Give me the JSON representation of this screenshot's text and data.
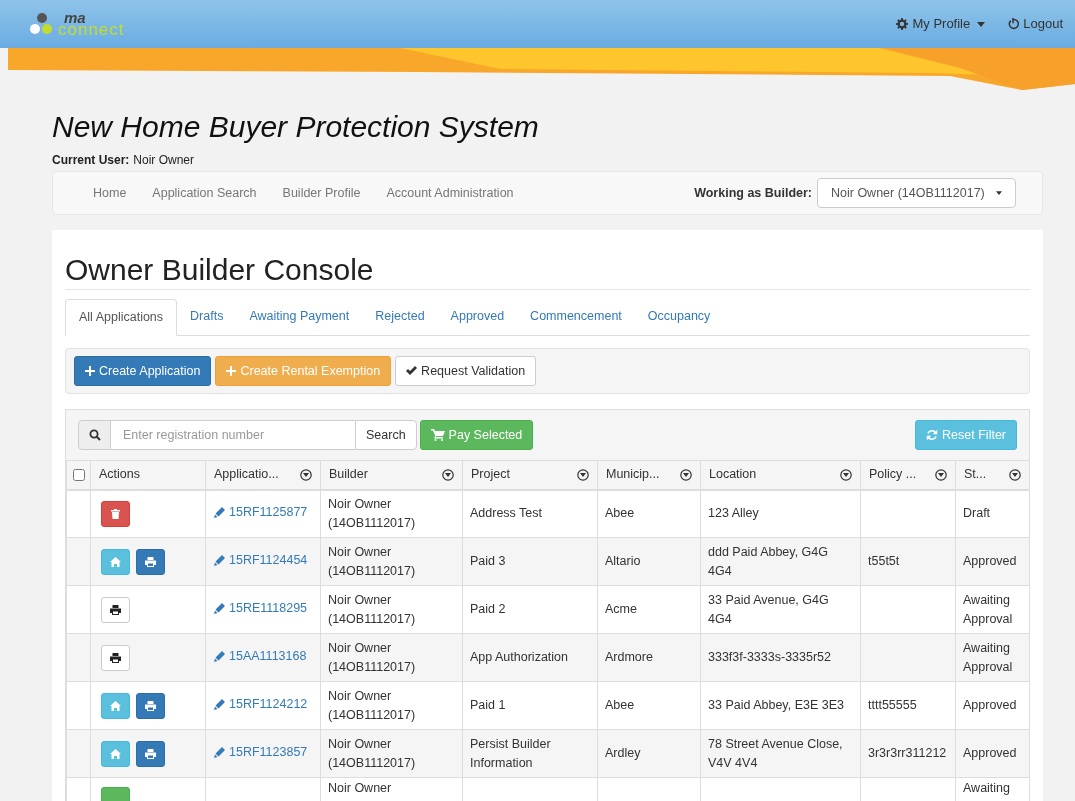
{
  "header": {
    "logo": {
      "top": "ma",
      "bottom": "connect"
    },
    "menu": [
      {
        "kind": "profile",
        "label": "My Profile"
      },
      {
        "kind": "logout",
        "label": "Logout"
      }
    ]
  },
  "page_title": "New Home Buyer Protection System",
  "current_user": {
    "label": "Current User:",
    "value": "Noir Owner"
  },
  "nav": {
    "links": [
      "Home",
      "Application Search",
      "Builder Profile",
      "Account Administration"
    ],
    "builder_label": "Working as Builder:",
    "builder_value": "Noir Owner (14OB1112017)"
  },
  "console": {
    "heading": "Owner Builder Console",
    "tabs": [
      {
        "label": "All Applications",
        "selected": true
      },
      {
        "label": "Drafts",
        "selected": false
      },
      {
        "label": "Awaiting Payment",
        "selected": false
      },
      {
        "label": "Rejected",
        "selected": false
      },
      {
        "label": "Approved",
        "selected": false
      },
      {
        "label": "Commencement",
        "selected": false
      },
      {
        "label": "Occupancy",
        "selected": false
      }
    ],
    "actions": [
      {
        "kind": "primary",
        "label": "Create Application"
      },
      {
        "kind": "warning",
        "label": "Create Rental Exemption"
      },
      {
        "kind": "default",
        "label": "Request Validation"
      }
    ],
    "search": {
      "placeholder": "Enter registration number",
      "button": "Search",
      "pay_button": "Pay Selected",
      "reset_button": "Reset Filter"
    },
    "table": {
      "select_all": {
        "checked": false
      },
      "columns": [
        "Actions",
        "Applicatio...",
        "Builder",
        "Project",
        "Municip...",
        "Location",
        "Policy ...",
        "St..."
      ],
      "rows": [
        {
          "actions": [
            {
              "kind": "delete"
            }
          ],
          "application": "15RF1125877",
          "builder": "Noir Owner (14OB1112017)",
          "project": "Address Test",
          "municipality": "Abee",
          "location": "123 Alley",
          "policy": "",
          "status": "Draft"
        },
        {
          "actions": [
            {
              "kind": "home"
            },
            {
              "kind": "print"
            }
          ],
          "application": "15RF1124454",
          "builder": "Noir Owner (14OB1112017)",
          "project": "Paid 3",
          "municipality": "Altario",
          "location": "ddd Paid Abbey, G4G 4G4",
          "policy": "t55t5t",
          "status": "Approved"
        },
        {
          "actions": [
            {
              "kind": "print-plain"
            }
          ],
          "application": "15RE1118295",
          "builder": "Noir Owner (14OB1112017)",
          "project": "Paid 2",
          "municipality": "Acme",
          "location": "33 Paid Avenue, G4G 4G4",
          "policy": "",
          "status": "Awaiting Approval"
        },
        {
          "actions": [
            {
              "kind": "print-plain"
            }
          ],
          "application": "15AA1113168",
          "builder": "Noir Owner (14OB1112017)",
          "project": "App Authorization",
          "municipality": "Ardmore",
          "location": "333f3f-3333s-3335r52",
          "policy": "",
          "status": "Awaiting Approval"
        },
        {
          "actions": [
            {
              "kind": "home"
            },
            {
              "kind": "print"
            }
          ],
          "application": "15RF1124212",
          "builder": "Noir Owner (14OB1112017)",
          "project": "Paid 1",
          "municipality": "Abee",
          "location": "33 Paid Abbey, E3E 3E3",
          "policy": "tttt55555",
          "status": "Approved"
        },
        {
          "actions": [
            {
              "kind": "home"
            },
            {
              "kind": "print"
            }
          ],
          "application": "15RF1123857",
          "builder": "Noir Owner (14OB1112017)",
          "project": "Persist Builder Information",
          "municipality": "Ardley",
          "location": "78 Street Avenue Close, V4V 4V4",
          "policy": "3r3r3rr311212",
          "status": "Approved"
        },
        {
          "actions": [
            {
              "kind": "success"
            }
          ],
          "application": "",
          "builder": "Noir Owner",
          "project": "",
          "municipality": "",
          "location": "",
          "policy": "",
          "status": "Awaiting"
        }
      ]
    }
  }
}
